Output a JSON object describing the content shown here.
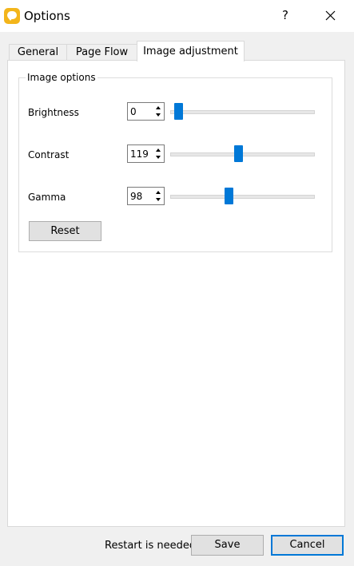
{
  "window": {
    "title": "Options",
    "help_glyph": "?",
    "app_icon": "speech-bubble-icon",
    "accent_color": "#0078d7",
    "icon_color": "#f3b51b"
  },
  "tabs": [
    {
      "label": "General",
      "active": false
    },
    {
      "label": "Page Flow",
      "active": false
    },
    {
      "label": "Image adjustment",
      "active": true
    }
  ],
  "image_options": {
    "group_title": "Image options",
    "rows": [
      {
        "label": "Brightness",
        "value": "0",
        "slider_level": 0.03
      },
      {
        "label": "Contrast",
        "value": "119",
        "slider_level": 0.47
      },
      {
        "label": "Gamma",
        "value": "98",
        "slider_level": 0.4
      }
    ],
    "reset_label": "Reset"
  },
  "footer": {
    "status_text": "Restart is needed",
    "save_label": "Save",
    "cancel_label": "Cancel"
  }
}
